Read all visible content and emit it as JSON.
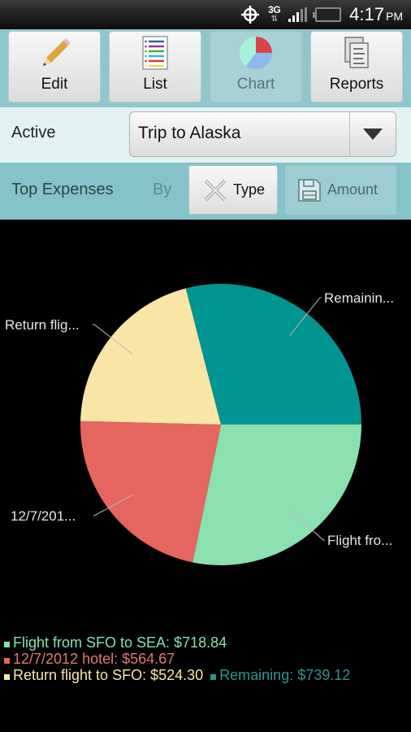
{
  "status_bar": {
    "time": "4:17",
    "ampm": "PM",
    "network": "3G",
    "icons": [
      "gps-icon",
      "network-3g-icon",
      "signal-icon",
      "battery-icon"
    ]
  },
  "toolbar": {
    "buttons": [
      {
        "label": "Edit",
        "icon": "pencil-icon",
        "active": false
      },
      {
        "label": "List",
        "icon": "list-icon",
        "active": false
      },
      {
        "label": "Chart",
        "icon": "pie-chart-icon",
        "active": true
      },
      {
        "label": "Reports",
        "icon": "reports-icon",
        "active": false
      }
    ]
  },
  "active_row": {
    "label": "Active",
    "selected": "Trip to Alaska"
  },
  "filter_row": {
    "title": "Top Expenses",
    "by_label": "By",
    "options": [
      {
        "label": "Type",
        "icon": "x-icon",
        "selected": true
      },
      {
        "label": "Amount",
        "icon": "floppy-disk-icon",
        "selected": false
      }
    ]
  },
  "chart_data": {
    "type": "pie",
    "title": "Top Expenses",
    "start_angle": "3 o'clock",
    "direction": "clockwise",
    "slices": [
      {
        "name": "Flight from SFO to SEA",
        "short_label": "Flight fro...",
        "value": 718.84,
        "display": "$718.84",
        "color": "#8be0b0"
      },
      {
        "name": "12/7/2012 hotel",
        "short_label": "12/7/201...",
        "value": 564.67,
        "display": "$564.67",
        "color": "#e5665f"
      },
      {
        "name": "Return flight to SFO",
        "short_label": "Return flig...",
        "value": 524.3,
        "display": "$524.30",
        "color": "#f9e6a6"
      },
      {
        "name": "Remaining",
        "short_label": "Remainin...",
        "value": 739.12,
        "display": "$739.12",
        "color": "#009590"
      }
    ],
    "legend": [
      {
        "text": "Flight from SFO to SEA: $718.84",
        "color": "#8be0b0"
      },
      {
        "text": "12/7/2012 hotel: $564.67",
        "color": "#e5665f"
      },
      {
        "text": "Return flight to SFO: $524.30",
        "color": "#f9e6a6"
      },
      {
        "text": "Remaining: $739.12",
        "color": "#2a9590"
      }
    ],
    "legend_placement": "bottom-left"
  }
}
